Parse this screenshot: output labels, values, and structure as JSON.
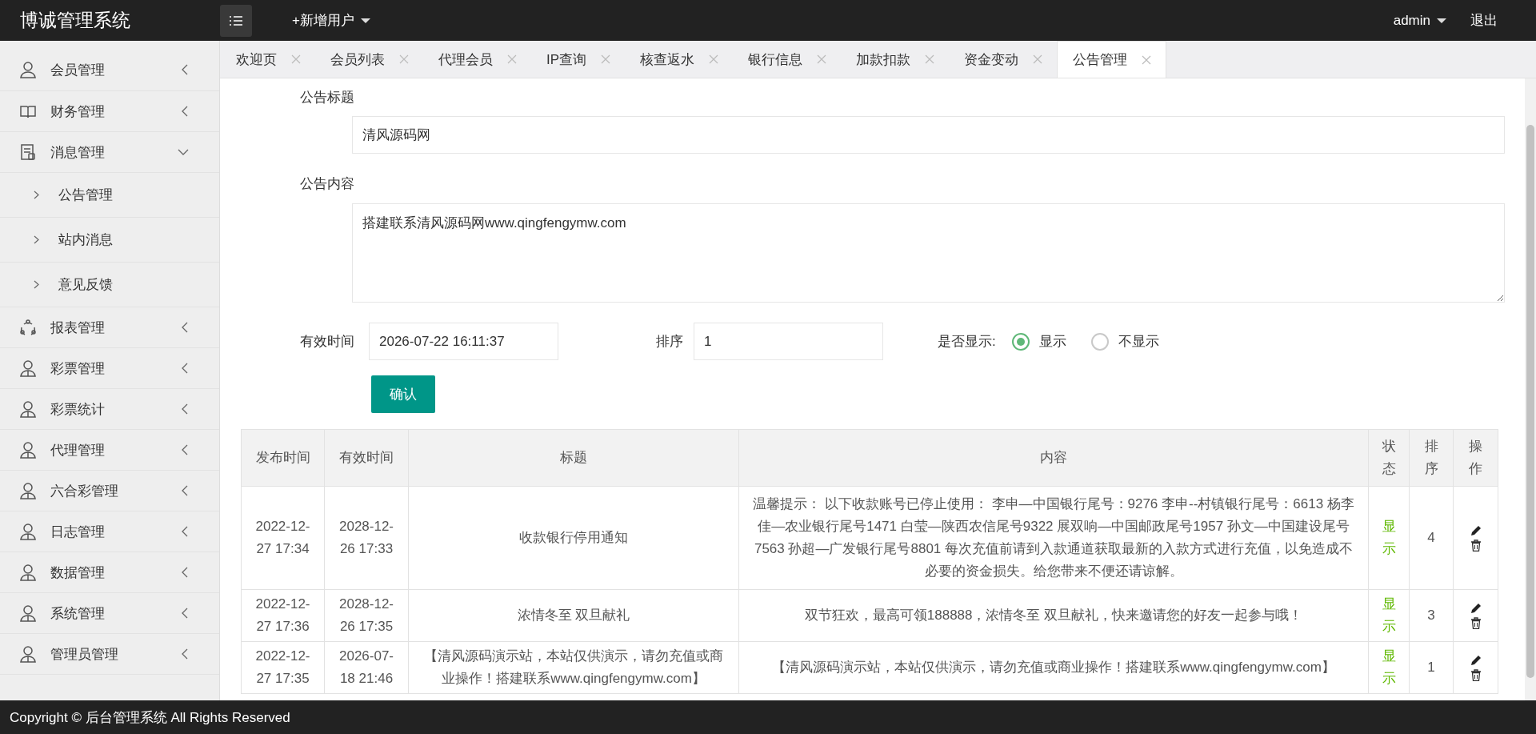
{
  "header": {
    "title": "博诚管理系统",
    "add_menu": "+新增用户",
    "user": "admin",
    "logout": "退出"
  },
  "sidebar": {
    "items": [
      {
        "label": "会员管理",
        "expanded": false
      },
      {
        "label": "财务管理",
        "expanded": false
      },
      {
        "label": "消息管理",
        "expanded": true,
        "children": [
          {
            "label": "公告管理"
          },
          {
            "label": "站内消息"
          },
          {
            "label": "意见反馈"
          }
        ]
      },
      {
        "label": "报表管理",
        "expanded": false
      },
      {
        "label": "彩票管理",
        "expanded": false
      },
      {
        "label": "彩票统计",
        "expanded": false
      },
      {
        "label": "代理管理",
        "expanded": false
      },
      {
        "label": "六合彩管理",
        "expanded": false
      },
      {
        "label": "日志管理",
        "expanded": false
      },
      {
        "label": "数据管理",
        "expanded": false
      },
      {
        "label": "系统管理",
        "expanded": false
      },
      {
        "label": "管理员管理",
        "expanded": false
      }
    ]
  },
  "tabs": [
    {
      "label": "欢迎页",
      "selected": false
    },
    {
      "label": "会员列表",
      "selected": false
    },
    {
      "label": "代理会员",
      "selected": false
    },
    {
      "label": "IP查询",
      "selected": false
    },
    {
      "label": "核查返水",
      "selected": false
    },
    {
      "label": "银行信息",
      "selected": false
    },
    {
      "label": "加款扣款",
      "selected": false
    },
    {
      "label": "资金变动",
      "selected": false
    },
    {
      "label": "公告管理",
      "selected": true
    }
  ],
  "form": {
    "title_label": "公告标题",
    "title_value": "清风源码网",
    "content_label": "公告内容",
    "content_value": "搭建联系清风源码网www.qingfengymw.com",
    "time_label": "有效时间",
    "time_value": "2026-07-22 16:11:37",
    "order_label": "排序",
    "order_value": "1",
    "display_label": "是否显示:",
    "display_options": [
      {
        "label": "显示",
        "selected": true
      },
      {
        "label": "不显示",
        "selected": false
      }
    ],
    "submit": "确认"
  },
  "table": {
    "columns": [
      "发布时间",
      "有效时间",
      "标题",
      "内容",
      "状态",
      "排序",
      "操作"
    ],
    "rows": [
      {
        "published": "2022-12-27 17:34",
        "valid": "2028-12-26 17:33",
        "title": "收款银行停用通知",
        "content": "温馨提示： 以下收款账号已停止使用： 李申—中国银行尾号：9276 李申--村镇银行尾号：6613 杨李佳—农业银行尾号1471 白莹—陕西农信尾号9322 展双响—中国邮政尾号1957 孙文—中国建设尾号7563 孙超—广发银行尾号8801 每次充值前请到入款通道获取最新的入款方式进行充值，以免造成不必要的资金损失。给您带来不便还请谅解。",
        "status": "显示",
        "order": "4"
      },
      {
        "published": "2022-12-27 17:36",
        "valid": "2028-12-26 17:35",
        "title": "浓情冬至 双旦献礼",
        "content": "双节狂欢，最高可领188888，浓情冬至 双旦献礼，快来邀请您的好友一起参与哦！",
        "status": "显示",
        "order": "3"
      },
      {
        "published": "2022-12-27 17:35",
        "valid": "2026-07-18 21:46",
        "title": "【清风源码演示站，本站仅供演示，请勿充值或商业操作！搭建联系www.qingfengymw.com】",
        "content": "【清风源码演示站，本站仅供演示，请勿充值或商业操作！搭建联系www.qingfengymw.com】",
        "status": "显示",
        "order": "1"
      }
    ]
  },
  "footer": "Copyright © 后台管理系统 All Rights Reserved"
}
